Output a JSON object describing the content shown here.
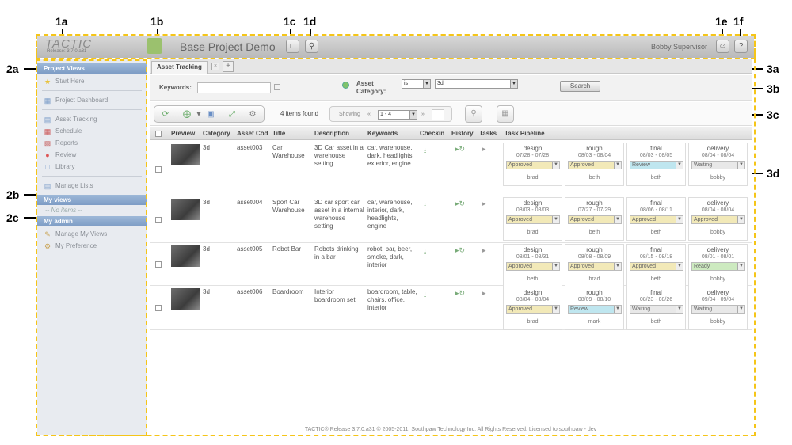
{
  "callouts": {
    "c1a": "1a",
    "c1b": "1b",
    "c1c": "1c",
    "c1d": "1d",
    "c1e": "1e",
    "c1f": "1f",
    "c2a": "2a",
    "c2b": "2b",
    "c2c": "2c",
    "c3a": "3a",
    "c3b": "3b",
    "c3c": "3c",
    "c3d": "3d"
  },
  "header": {
    "logo": "TACTIC",
    "release": "Release: 3.7.0.a31",
    "project_title": "Base Project Demo",
    "user": "Bobby Supervisor"
  },
  "sidebar": {
    "project_views_title": "Project Views",
    "start_here": "Start Here",
    "project_dashboard": "Project Dashboard",
    "asset_tracking": "Asset Tracking",
    "schedule": "Schedule",
    "reports": "Reports",
    "review": "Review",
    "library": "Library",
    "manage_lists": "Manage Lists",
    "my_views_title": "My views",
    "no_items": "-- No items --",
    "my_admin_title": "My admin",
    "manage_my_views": "Manage My Views",
    "my_preference": "My Preference"
  },
  "tabs": {
    "active": "Asset Tracking",
    "close": "×",
    "add": "+"
  },
  "search": {
    "keywords_label": "Keywords:",
    "keywords_value": "",
    "asset_category_label": "Asset Category:",
    "op": "is",
    "category": "3d",
    "button": "Search"
  },
  "toolbar": {
    "items_found": "4 items found",
    "showing": "Showing",
    "page": "1 - 4"
  },
  "columns": {
    "preview": "Preview",
    "category": "Category",
    "code": "Asset Cod",
    "title": "Title",
    "description": "Description",
    "keywords": "Keywords",
    "checkin": "Checkin",
    "history": "History",
    "tasks": "Tasks",
    "pipeline": "Task Pipeline"
  },
  "rows": [
    {
      "category": "3d",
      "code": "asset003",
      "title": "Car Warehouse",
      "description": "3D Car asset in a warehouse setting",
      "keywords": "car, warehouse, dark, headlights, exterior, engine",
      "tasks": [
        {
          "name": "design",
          "dates": "07/28 - 07/28",
          "status": "Approved",
          "user": "brad",
          "color": "#f2e9b8"
        },
        {
          "name": "rough",
          "dates": "08/03 - 08/04",
          "status": "Approved",
          "user": "beth",
          "color": "#f2e9b8"
        },
        {
          "name": "final",
          "dates": "08/03 - 08/05",
          "status": "Review",
          "user": "beth",
          "color": "#bfe6ef"
        },
        {
          "name": "delivery",
          "dates": "08/04 - 08/04",
          "status": "Waiting",
          "user": "bobby",
          "color": "#e8e8e8"
        }
      ]
    },
    {
      "category": "3d",
      "code": "asset004",
      "title": "Sport Car Warehouse",
      "description": "3D car sport car asset in a internal warehouse setting",
      "keywords": "car, warehouse, interior, dark, headlights, engine",
      "tasks": [
        {
          "name": "design",
          "dates": "08/03 - 08/03",
          "status": "Approved",
          "user": "brad",
          "color": "#f2e9b8"
        },
        {
          "name": "rough",
          "dates": "07/27 - 07/29",
          "status": "Approved",
          "user": "beth",
          "color": "#f2e9b8"
        },
        {
          "name": "final",
          "dates": "08/06 - 08/11",
          "status": "Approved",
          "user": "beth",
          "color": "#f2e9b8"
        },
        {
          "name": "delivery",
          "dates": "08/04 - 08/04",
          "status": "Approved",
          "user": "bobby",
          "color": "#f2e9b8"
        }
      ]
    },
    {
      "category": "3d",
      "code": "asset005",
      "title": "Robot Bar",
      "description": "Robots drinking in a bar",
      "keywords": "robot, bar, beer, smoke, dark, interior",
      "tasks": [
        {
          "name": "design",
          "dates": "08/01 - 08/31",
          "status": "Approved",
          "user": "beth",
          "color": "#f2e9b8"
        },
        {
          "name": "rough",
          "dates": "08/08 - 08/09",
          "status": "Approved",
          "user": "brad",
          "color": "#f2e9b8"
        },
        {
          "name": "final",
          "dates": "08/15 - 08/18",
          "status": "Approved",
          "user": "beth",
          "color": "#f2e9b8"
        },
        {
          "name": "delivery",
          "dates": "08/01 - 08/01",
          "status": "Ready",
          "user": "bobby",
          "color": "#cdeac0"
        }
      ]
    },
    {
      "category": "3d",
      "code": "asset006",
      "title": "Boardroom",
      "description": "Interior boardroom set",
      "keywords": "boardroom, table, chairs, office, interior",
      "tasks": [
        {
          "name": "design",
          "dates": "08/04 - 08/04",
          "status": "Approved",
          "user": "brad",
          "color": "#f2e9b8"
        },
        {
          "name": "rough",
          "dates": "08/09 - 08/10",
          "status": "Review",
          "user": "mark",
          "color": "#bfe6ef"
        },
        {
          "name": "final",
          "dates": "08/23 - 08/26",
          "status": "Waiting",
          "user": "beth",
          "color": "#e8e8e8"
        },
        {
          "name": "delivery",
          "dates": "09/04 - 09/04",
          "status": "Waiting",
          "user": "bobby",
          "color": "#e8e8e8"
        }
      ]
    }
  ],
  "footer": "TACTIC® Release 3.7.0.a31   © 2005-2011, Southpaw Technology Inc.   All Rights Reserved.   Licensed to southpaw - dev"
}
